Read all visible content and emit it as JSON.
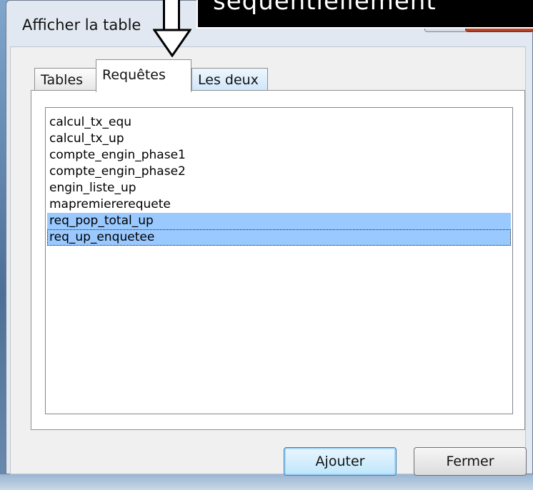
{
  "callout": {
    "text": "séquentiellement"
  },
  "dialog": {
    "title": "Afficher la table",
    "tabs": [
      {
        "label": "Tables",
        "active": false
      },
      {
        "label": "Requêtes",
        "active": true
      },
      {
        "label": "Les deux",
        "active": false
      }
    ],
    "list_items": [
      {
        "label": "calcul_tx_equ",
        "selected": false
      },
      {
        "label": "calcul_tx_up",
        "selected": false
      },
      {
        "label": "compte_engin_phase1",
        "selected": false
      },
      {
        "label": "compte_engin_phase2",
        "selected": false
      },
      {
        "label": "engin_liste_up",
        "selected": false
      },
      {
        "label": "mapremiererequete",
        "selected": false
      },
      {
        "label": "req_pop_total_up",
        "selected": true
      },
      {
        "label": "req_up_enquetee",
        "selected": true
      }
    ],
    "buttons": {
      "add": "Ajouter",
      "close": "Fermer"
    }
  },
  "colors": {
    "selection": "#99c9ff",
    "dialog_frame": "#e2e8f1",
    "close_button": "#c44a2c"
  }
}
